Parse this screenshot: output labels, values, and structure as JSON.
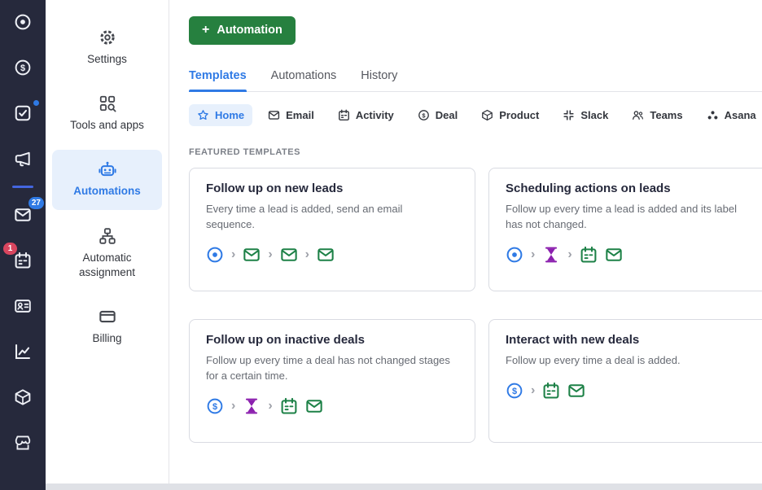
{
  "palette": {
    "accent": "#2f7ae5",
    "button_green": "#26803f",
    "flow_green": "#1d8147",
    "flow_purple": "#8b1fae",
    "badge_blue": "#2f7ae5",
    "badge_red": "#d9465f",
    "sidebar_bg": "#26293c"
  },
  "left_rail": {
    "items": [
      {
        "name": "leads",
        "icon": "lead-icon"
      },
      {
        "name": "deals",
        "icon": "deal-icon"
      },
      {
        "name": "activities",
        "icon": "checklist-icon",
        "dot": true
      },
      {
        "name": "campaigns",
        "icon": "megaphone-icon",
        "divider_after": true
      },
      {
        "name": "mail",
        "icon": "email-icon",
        "badge": "27",
        "badge_color": "#2f7ae5",
        "badge_side": "right"
      },
      {
        "name": "calendar",
        "icon": "activity-icon",
        "badge": "1",
        "badge_color": "#d9465f",
        "badge_side": "left"
      },
      {
        "name": "contacts",
        "icon": "contact-card-icon"
      },
      {
        "name": "insights",
        "icon": "insights-icon"
      },
      {
        "name": "products",
        "icon": "package-icon"
      },
      {
        "name": "marketplace",
        "icon": "marketplace-icon"
      }
    ]
  },
  "settings_nav": {
    "items": [
      {
        "name": "settings",
        "label": "Settings",
        "icon": "gear-icon",
        "active": false
      },
      {
        "name": "tools-and-apps",
        "label": "Tools and apps",
        "icon": "tools-icon",
        "active": false
      },
      {
        "name": "automations",
        "label": "Automations",
        "icon": "robot-icon",
        "active": true
      },
      {
        "name": "automatic-assignment",
        "label": "Automatic assignment",
        "icon": "org-chart-icon",
        "active": false
      },
      {
        "name": "billing",
        "label": "Billing",
        "icon": "credit-card-icon",
        "active": false
      }
    ]
  },
  "header": {
    "new_automation": {
      "plus": "+",
      "label": "Automation"
    }
  },
  "tabs": [
    {
      "name": "templates",
      "label": "Templates",
      "active": true
    },
    {
      "name": "automations",
      "label": "Automations",
      "active": false
    },
    {
      "name": "history",
      "label": "History",
      "active": false
    }
  ],
  "filters": [
    {
      "name": "home",
      "label": "Home",
      "icon": "star-icon",
      "active": true
    },
    {
      "name": "email",
      "label": "Email",
      "icon": "email-icon",
      "active": false
    },
    {
      "name": "activity",
      "label": "Activity",
      "icon": "activity-icon",
      "active": false
    },
    {
      "name": "deal",
      "label": "Deal",
      "icon": "deal-icon",
      "active": false
    },
    {
      "name": "product",
      "label": "Product",
      "icon": "package-icon",
      "active": false
    },
    {
      "name": "slack",
      "label": "Slack",
      "icon": "slack-icon",
      "active": false
    },
    {
      "name": "teams",
      "label": "Teams",
      "icon": "teams-icon",
      "active": false
    },
    {
      "name": "asana",
      "label": "Asana",
      "icon": "asana-icon",
      "active": false
    }
  ],
  "section_title": "FEATURED TEMPLATES",
  "cards": [
    {
      "title": "Follow up on new leads",
      "description": "Every time a lead is added, send an email sequence.",
      "flow": [
        [
          "lead-icon"
        ],
        [
          "email-icon"
        ],
        [
          "email-icon"
        ],
        [
          "email-icon"
        ]
      ]
    },
    {
      "title": "Scheduling actions on leads",
      "description": "Follow up every time a lead is added and its label has not changed.",
      "flow": [
        [
          "lead-icon"
        ],
        [
          "delay-icon"
        ],
        [
          "activity-icon",
          "email-icon"
        ]
      ]
    },
    {
      "title": "Follow up on inactive deals",
      "description": "Follow up every time a deal has not changed stages for a certain time.",
      "flow": [
        [
          "deal-icon"
        ],
        [
          "delay-icon"
        ],
        [
          "activity-icon",
          "email-icon"
        ]
      ]
    },
    {
      "title": "Interact with new deals",
      "description": "Follow up every time a deal is added.",
      "flow": [
        [
          "deal-icon"
        ],
        [
          "activity-icon",
          "email-icon"
        ]
      ]
    }
  ]
}
